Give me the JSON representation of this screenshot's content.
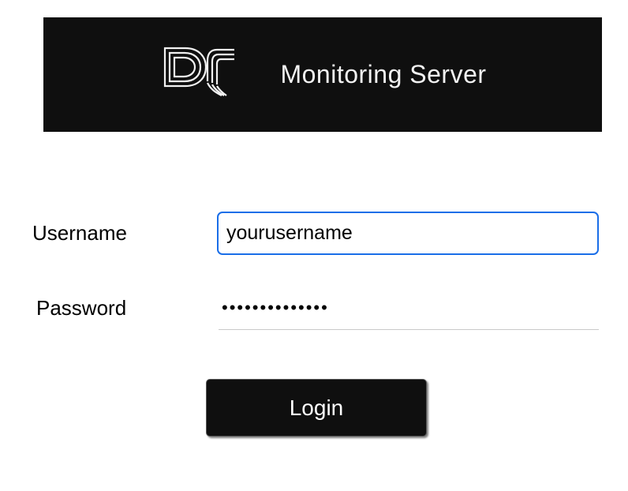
{
  "header": {
    "title": "Monitoring Server",
    "logo_name": "dc-logo"
  },
  "form": {
    "username_label": "Username",
    "username_value": "yourusername",
    "password_label": "Password",
    "password_value": "••••••••••••••",
    "login_button_label": "Login"
  }
}
